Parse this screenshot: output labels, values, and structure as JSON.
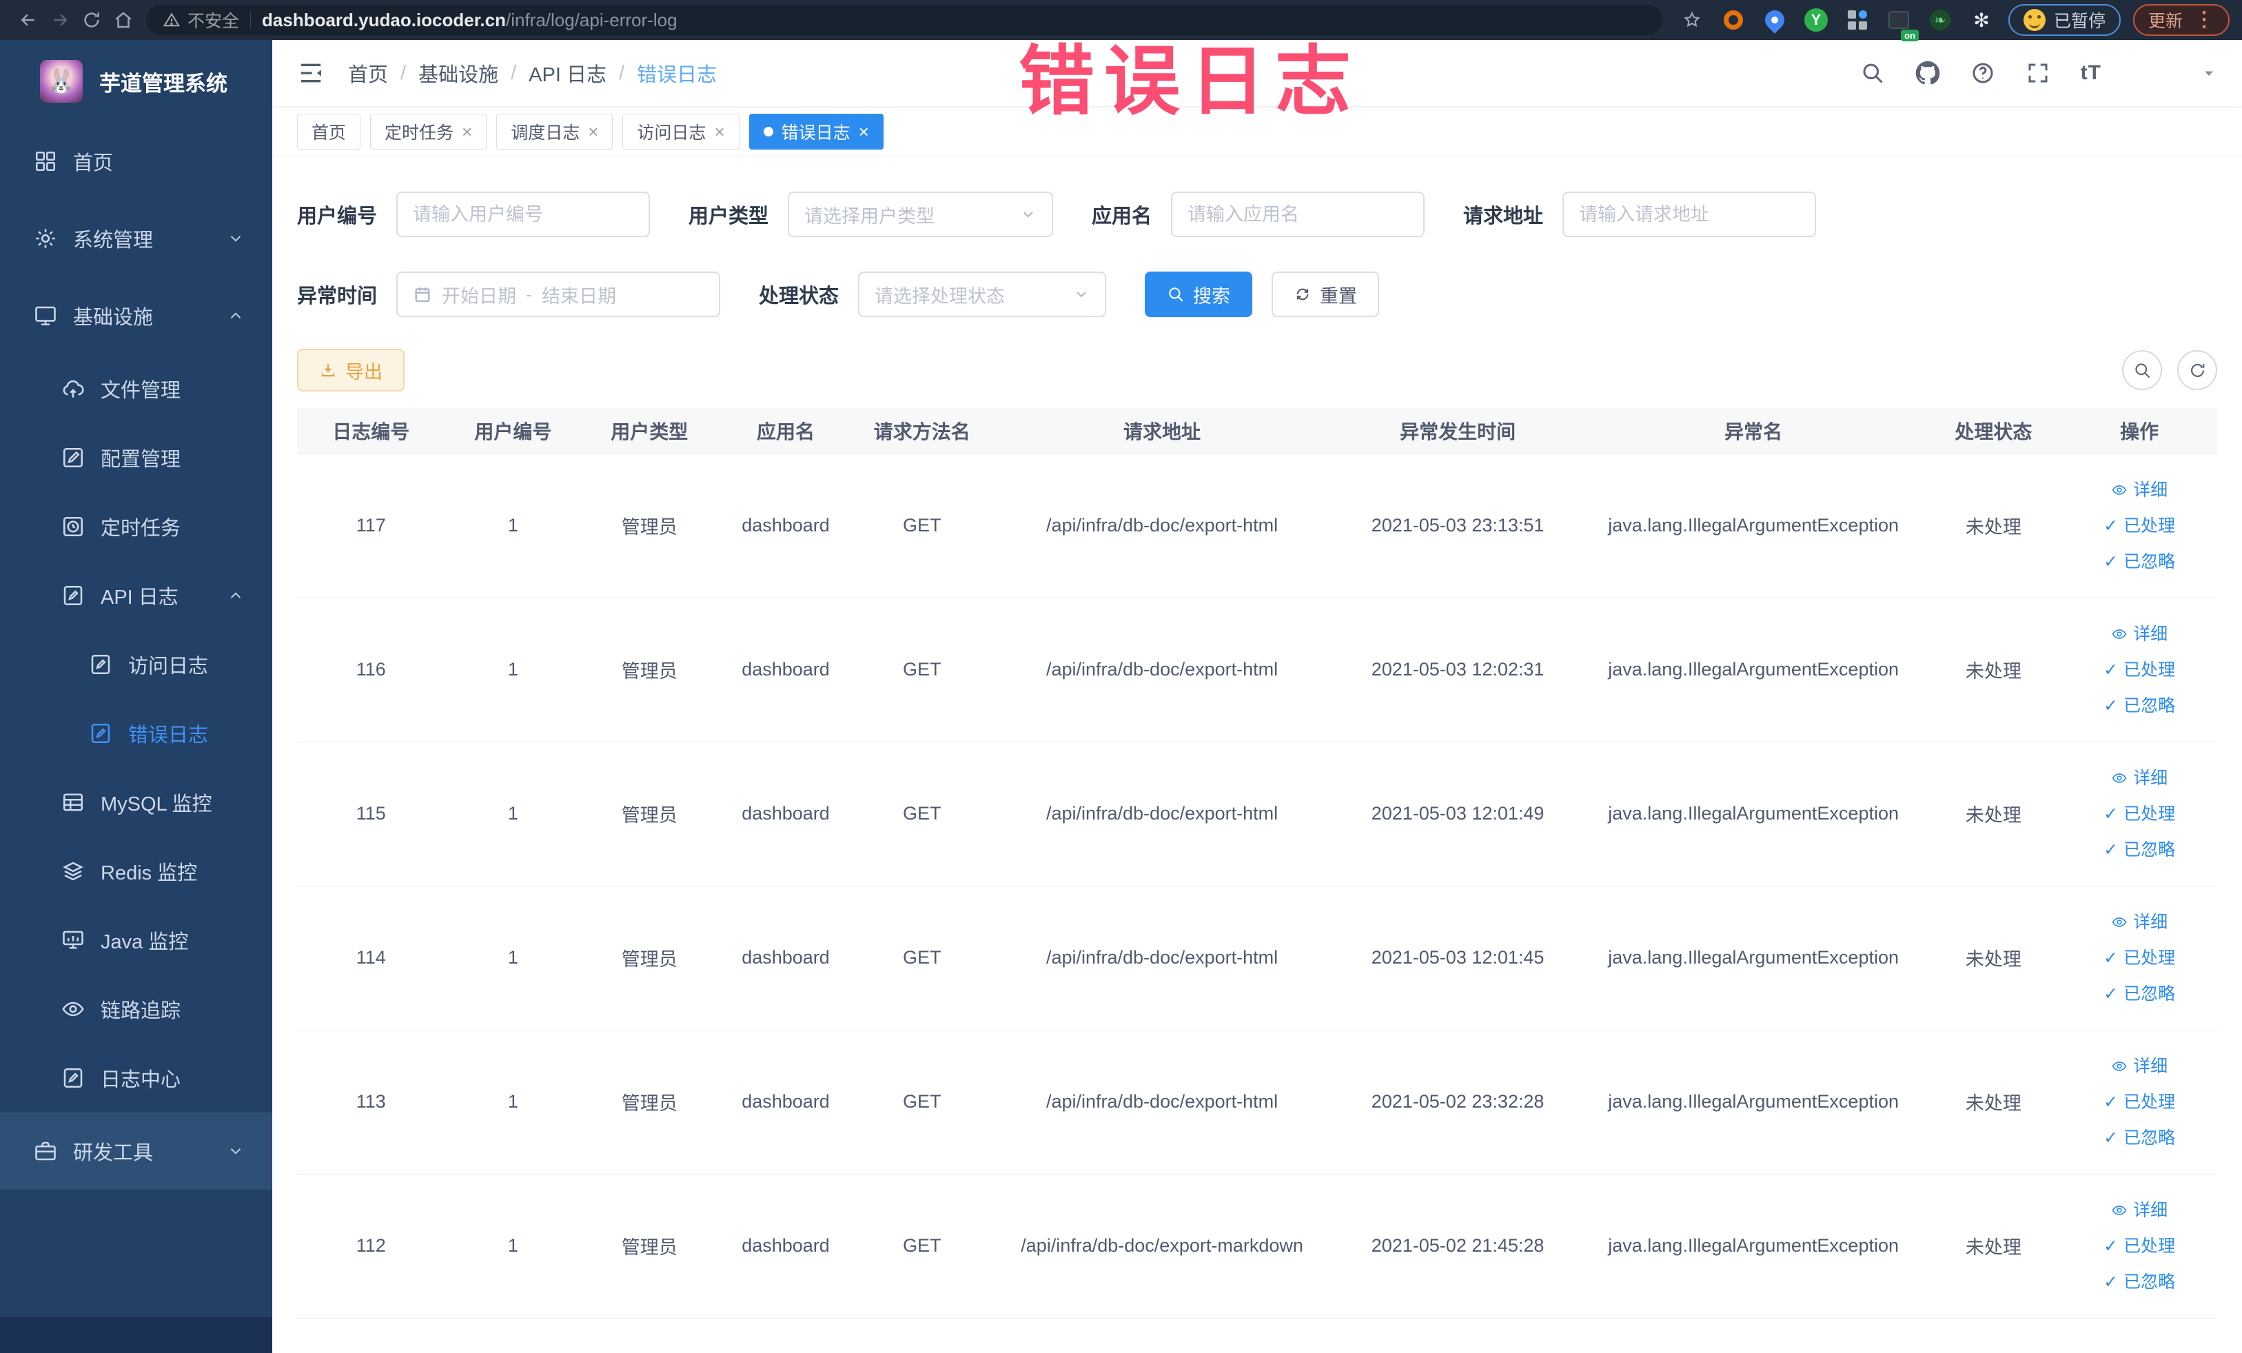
{
  "colors": {
    "primary": "#2d8cf0",
    "warning": "#e6a23c",
    "watermark_pink": "#fb4e73",
    "sidebar_bg": "#234066",
    "browser_bar_bg": "#202c3c"
  },
  "browser": {
    "security_label": "不安全",
    "url_host": "dashboard.yudao.iocoder.cn",
    "url_path": "/infra/log/api-error-log",
    "paused_label": "已暂停",
    "update_label": "更新"
  },
  "watermark_text": "错误日志",
  "sidebar": {
    "title": "芋道管理系统",
    "items": [
      {
        "id": "home",
        "label": "首页",
        "icon": "home-icon",
        "level": 1
      },
      {
        "id": "system",
        "label": "系统管理",
        "icon": "gear-icon",
        "level": 1,
        "arrow": "down"
      },
      {
        "id": "infra",
        "label": "基础设施",
        "icon": "monitor-icon",
        "level": 1,
        "arrow": "up"
      },
      {
        "id": "file",
        "label": "文件管理",
        "icon": "cloud-upload-icon",
        "level": 2
      },
      {
        "id": "config",
        "label": "配置管理",
        "icon": "edit-icon",
        "level": 2
      },
      {
        "id": "job",
        "label": "定时任务",
        "icon": "clock-icon",
        "level": 2
      },
      {
        "id": "api-log",
        "label": "API 日志",
        "icon": "doc-edit-icon",
        "level": 2,
        "arrow": "up"
      },
      {
        "id": "access-log",
        "label": "访问日志",
        "icon": "doc-edit-icon",
        "level": 3
      },
      {
        "id": "error-log",
        "label": "错误日志",
        "icon": "doc-edit-icon",
        "level": 3,
        "active": true
      },
      {
        "id": "mysql",
        "label": "MySQL 监控",
        "icon": "database-icon",
        "level": 2
      },
      {
        "id": "redis",
        "label": "Redis 监控",
        "icon": "layers-icon",
        "level": 2
      },
      {
        "id": "java",
        "label": "Java 监控",
        "icon": "java-monitor-icon",
        "level": 2
      },
      {
        "id": "tracer",
        "label": "链路追踪",
        "icon": "eye-icon",
        "level": 2
      },
      {
        "id": "log-center",
        "label": "日志中心",
        "icon": "doc-edit-icon",
        "level": 2
      },
      {
        "id": "dev-tools",
        "label": "研发工具",
        "icon": "briefcase-icon",
        "level": 1,
        "arrow": "down",
        "section": true
      }
    ]
  },
  "header": {
    "breadcrumb": [
      "首页",
      "基础设施",
      "API 日志",
      "错误日志"
    ]
  },
  "tabs": [
    {
      "label": "首页",
      "closable": false,
      "active": false
    },
    {
      "label": "定时任务",
      "closable": true,
      "active": false
    },
    {
      "label": "调度日志",
      "closable": true,
      "active": false
    },
    {
      "label": "访问日志",
      "closable": true,
      "active": false
    },
    {
      "label": "错误日志",
      "closable": true,
      "active": true
    }
  ],
  "filters": {
    "user_id": {
      "label": "用户编号",
      "placeholder": "请输入用户编号"
    },
    "user_type": {
      "label": "用户类型",
      "placeholder": "请选择用户类型"
    },
    "app_name": {
      "label": "应用名",
      "placeholder": "请输入应用名"
    },
    "request_url": {
      "label": "请求地址",
      "placeholder": "请输入请求地址"
    },
    "exception_time": {
      "label": "异常时间",
      "start_placeholder": "开始日期",
      "separator": "-",
      "end_placeholder": "结束日期"
    },
    "process_status": {
      "label": "处理状态",
      "placeholder": "请选择处理状态"
    },
    "search_label": "搜索",
    "reset_label": "重置"
  },
  "toolbar": {
    "export_label": "导出"
  },
  "table": {
    "columns": [
      "日志编号",
      "用户编号",
      "用户类型",
      "应用名",
      "请求方法名",
      "请求地址",
      "异常发生时间",
      "异常名",
      "处理状态",
      "操作"
    ],
    "col_widths": [
      "7.7%",
      "7.1%",
      "7.1%",
      "7.1%",
      "7.1%",
      "17.9%",
      "12.9%",
      "17.9%",
      "7.1%",
      "8.1%"
    ],
    "row_actions": [
      "详细",
      "已处理",
      "已忽略"
    ],
    "rows": [
      {
        "id": "117",
        "user_id": "1",
        "user_type": "管理员",
        "app": "dashboard",
        "method": "GET",
        "url": "/api/infra/db-doc/export-html",
        "time": "2021-05-03 23:13:51",
        "exception": "java.lang.IllegalArgumentException",
        "status": "未处理"
      },
      {
        "id": "116",
        "user_id": "1",
        "user_type": "管理员",
        "app": "dashboard",
        "method": "GET",
        "url": "/api/infra/db-doc/export-html",
        "time": "2021-05-03 12:02:31",
        "exception": "java.lang.IllegalArgumentException",
        "status": "未处理"
      },
      {
        "id": "115",
        "user_id": "1",
        "user_type": "管理员",
        "app": "dashboard",
        "method": "GET",
        "url": "/api/infra/db-doc/export-html",
        "time": "2021-05-03 12:01:49",
        "exception": "java.lang.IllegalArgumentException",
        "status": "未处理"
      },
      {
        "id": "114",
        "user_id": "1",
        "user_type": "管理员",
        "app": "dashboard",
        "method": "GET",
        "url": "/api/infra/db-doc/export-html",
        "time": "2021-05-03 12:01:45",
        "exception": "java.lang.IllegalArgumentException",
        "status": "未处理"
      },
      {
        "id": "113",
        "user_id": "1",
        "user_type": "管理员",
        "app": "dashboard",
        "method": "GET",
        "url": "/api/infra/db-doc/export-html",
        "time": "2021-05-02 23:32:28",
        "exception": "java.lang.IllegalArgumentException",
        "status": "未处理"
      },
      {
        "id": "112",
        "user_id": "1",
        "user_type": "管理员",
        "app": "dashboard",
        "method": "GET",
        "url": "/api/infra/db-doc/export-markdown",
        "time": "2021-05-02 21:45:28",
        "exception": "java.lang.IllegalArgumentException",
        "status": "未处理"
      }
    ]
  }
}
